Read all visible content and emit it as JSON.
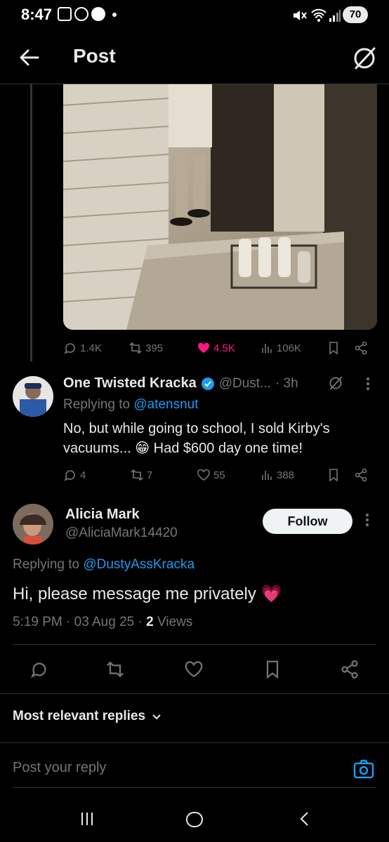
{
  "status": {
    "time": "8:47",
    "battery": "70"
  },
  "header": {
    "title": "Post",
    "back_icon": "arrow-left-icon",
    "grok_icon": "grok-icon"
  },
  "photo_post": {
    "photo_alt": "vintage photo",
    "stats": {
      "replies": "1.4K",
      "reposts": "395",
      "likes": "4.5K",
      "views": "106K"
    }
  },
  "reply": {
    "name": "One Twisted Kracka",
    "handle": "@Dust...",
    "time": "· 3h",
    "replying_prefix": "Replying to ",
    "replying_to": "@atensnut",
    "text_line1": "No, but while going to school, I sold Kirby's",
    "text_line2": "vacuums... 😁 Had $600 day one time!",
    "stats": {
      "replies": "4",
      "reposts": "7",
      "likes": "55",
      "views": "388"
    }
  },
  "main_post": {
    "name": "Alicia Mark",
    "handle": "@AliciaMark14420",
    "follow_label": "Follow",
    "replying_prefix": "Replying to ",
    "replying_to": "@DustyAssKracka",
    "text": "Hi, please message me privately 💗",
    "meta_time": "5:19 PM · 03 Aug 25 · ",
    "views_count": "2",
    "views_label": " Views"
  },
  "sort": {
    "label": "Most relevant replies"
  },
  "composer": {
    "placeholder": "Post your reply"
  },
  "colors": {
    "accent": "#1d9bf0",
    "like": "#f91880",
    "verified": "#1d9bf0"
  }
}
